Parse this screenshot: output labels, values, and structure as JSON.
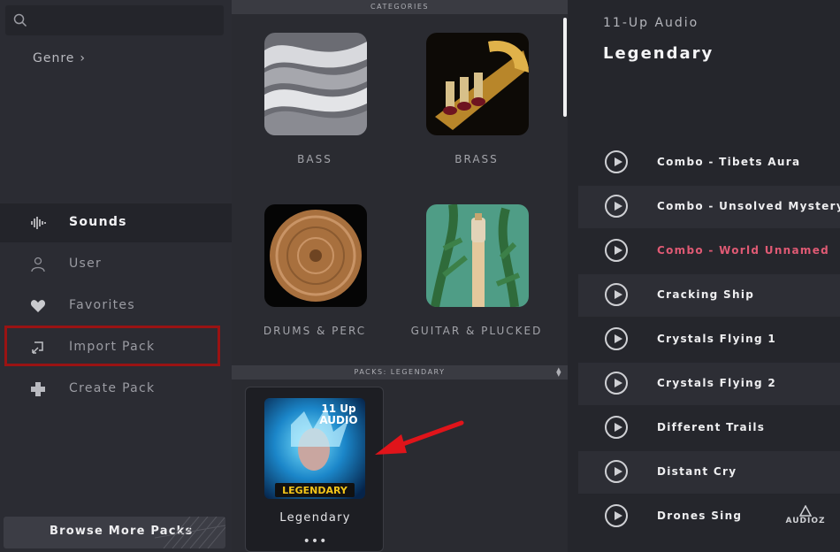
{
  "sidebar": {
    "search_placeholder": "",
    "genre_label": "Genre",
    "nav": [
      {
        "label": "Sounds",
        "icon": "waveform-icon",
        "active": true
      },
      {
        "label": "User",
        "icon": "user-icon"
      },
      {
        "label": "Favorites",
        "icon": "heart-icon"
      },
      {
        "label": "Import Pack",
        "icon": "import-icon",
        "highlighted": true
      },
      {
        "label": "Create Pack",
        "icon": "puzzle-icon"
      }
    ],
    "browse_label": "Browse More Packs"
  },
  "categories": {
    "header": "CATEGORIES",
    "items": [
      {
        "label": "BASS"
      },
      {
        "label": "BRASS"
      },
      {
        "label": "DRUMS & PERC"
      },
      {
        "label": "GUITAR & PLUCKED"
      }
    ]
  },
  "packs": {
    "header": "PACKS: LEGENDARY",
    "items": [
      {
        "name": "Legendary",
        "art_brand": "11 Up AUDIO",
        "art_title": "LEGENDARY",
        "more": "•••"
      }
    ]
  },
  "detail": {
    "artist": "11-Up Audio",
    "title": "Legendary",
    "tracks": [
      {
        "name": "Combo - Tibets Aura"
      },
      {
        "name": "Combo - Unsolved Mystery"
      },
      {
        "name": "Combo - World Unnamed",
        "playing": true
      },
      {
        "name": "Cracking Ship"
      },
      {
        "name": "Crystals Flying 1"
      },
      {
        "name": "Crystals Flying 2"
      },
      {
        "name": "Different Trails"
      },
      {
        "name": "Distant Cry"
      },
      {
        "name": "Drones Sing"
      }
    ]
  },
  "watermark": "AUDIOZ",
  "colors": {
    "accent_playing": "#e05a74",
    "highlight_box": "#9a1313",
    "annotation_arrow": "#e0141a"
  }
}
